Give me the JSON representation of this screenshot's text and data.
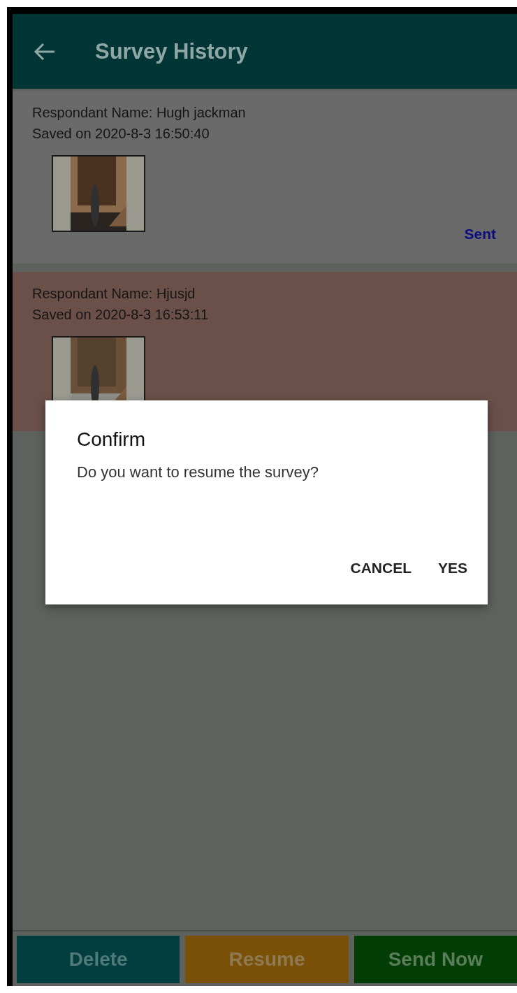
{
  "app_bar": {
    "title": "Survey History"
  },
  "surveys": [
    {
      "name_line": "Respondant Name: Hugh jackman",
      "saved_line": "Saved on 2020-8-3 16:50:40",
      "status": "Sent",
      "selected": false
    },
    {
      "name_line": "Respondant Name: Hjusjd",
      "saved_line": "Saved on 2020-8-3 16:53:11",
      "selected": true
    }
  ],
  "dialog": {
    "title": "Confirm",
    "message": "Do you want to resume the survey?",
    "buttons": [
      "CANCEL",
      "YES"
    ]
  },
  "bottom_buttons": [
    {
      "label": "Delete",
      "kind": "delete"
    },
    {
      "label": "Resume",
      "kind": "resume"
    },
    {
      "label": "Send Now",
      "kind": "send"
    }
  ]
}
